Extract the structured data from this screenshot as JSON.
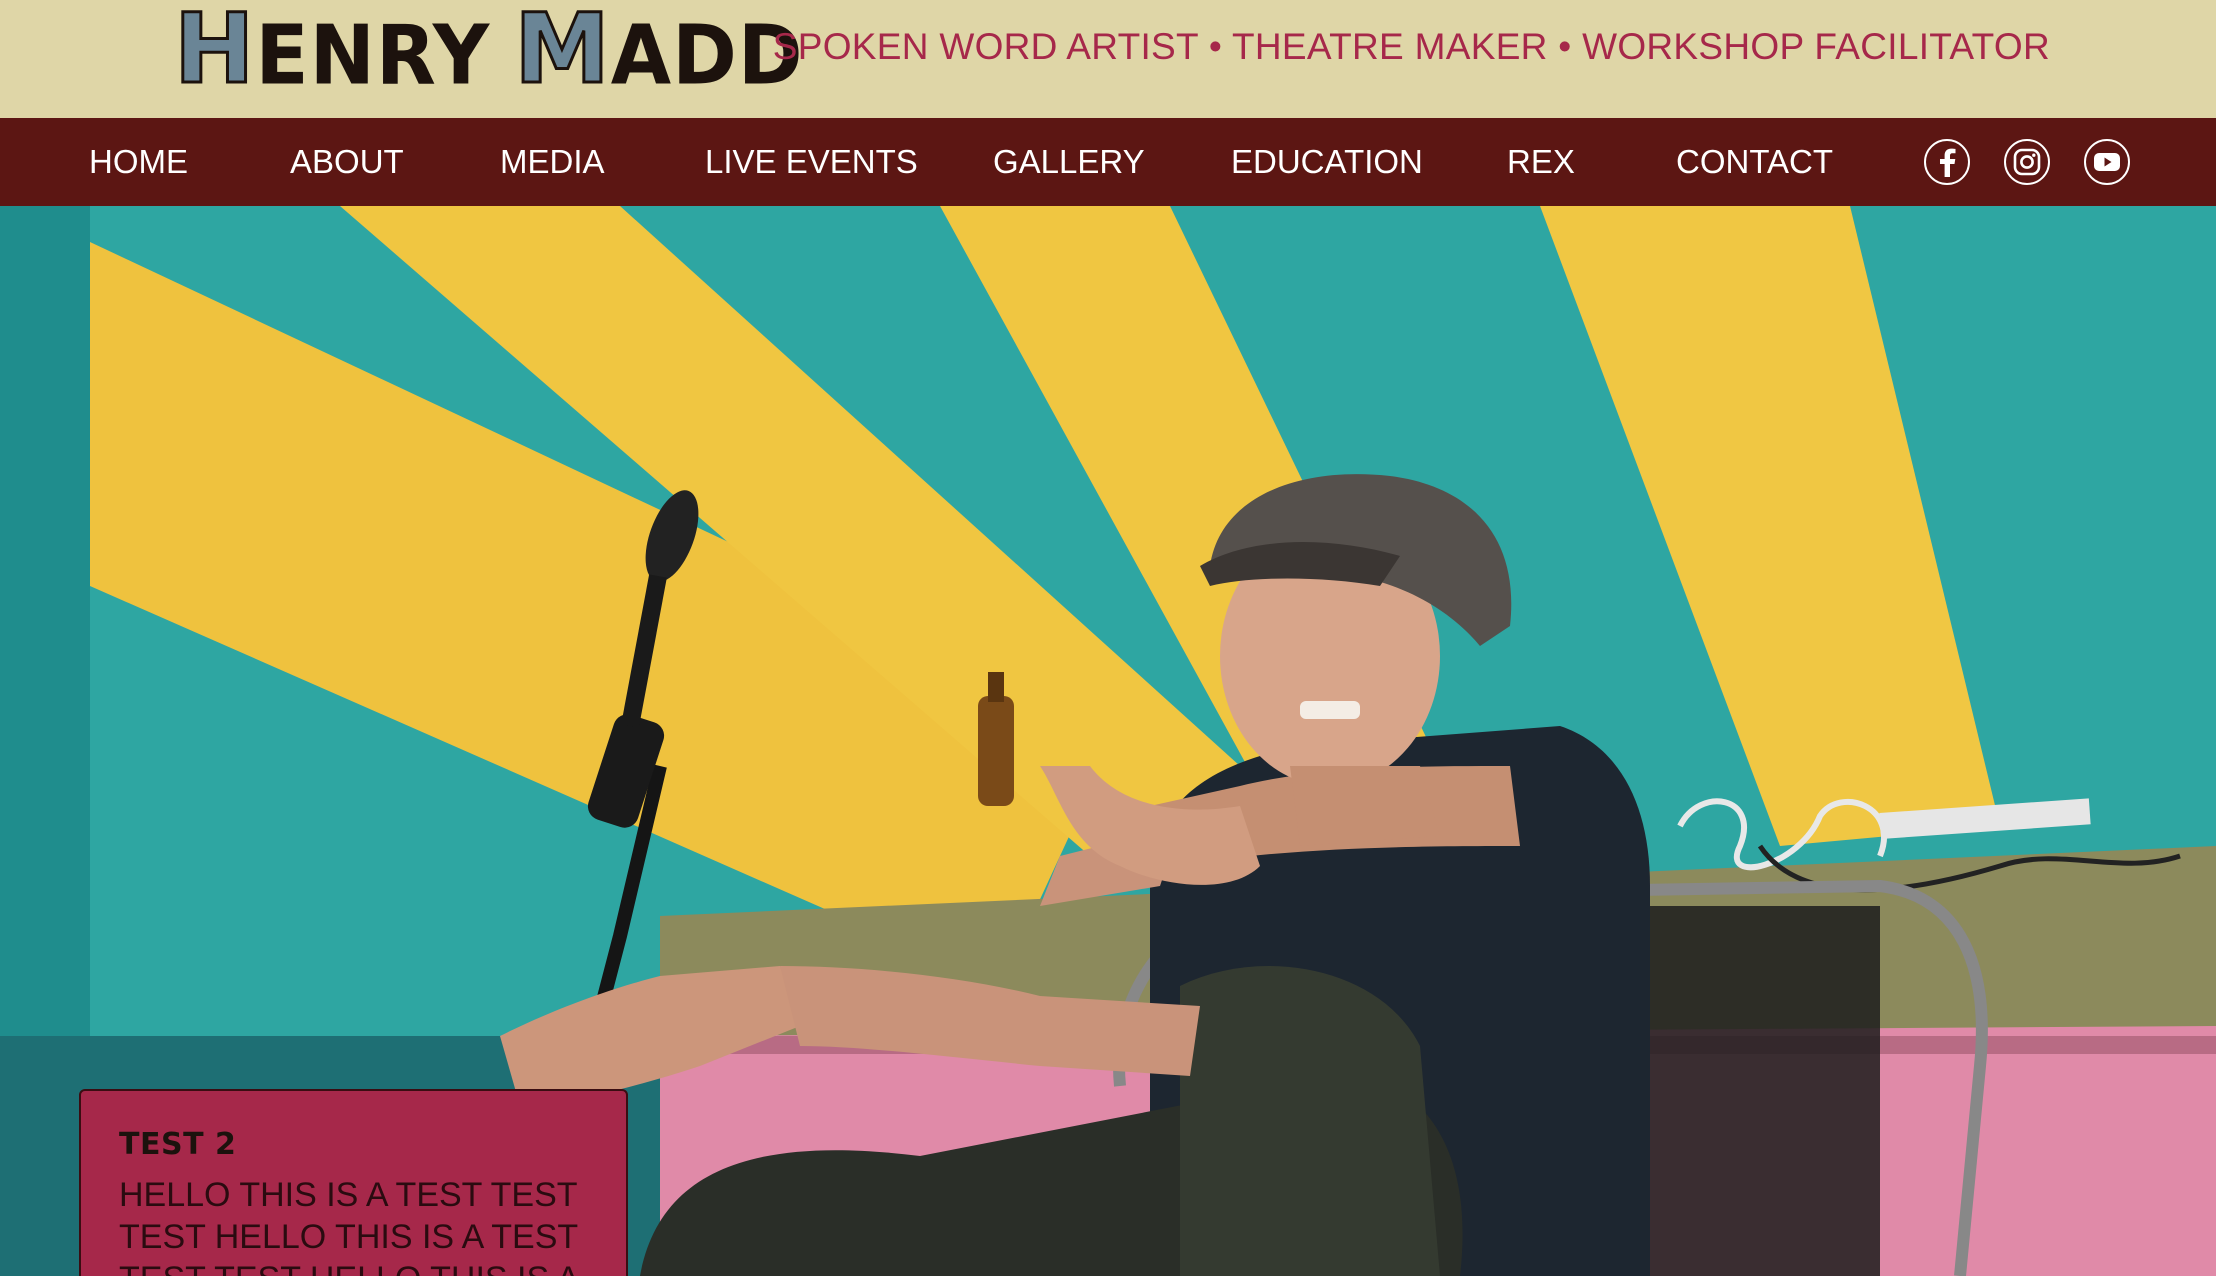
{
  "brand": {
    "first_initial": "H",
    "first_rest": "ENRY",
    "last_initial": "M",
    "last_rest": "ADD"
  },
  "header": {
    "tagline": "SPOKEN WORD ARTIST • THEATRE MAKER • WORKSHOP FACILITATOR"
  },
  "nav": {
    "items": [
      {
        "label": "HOME"
      },
      {
        "label": "ABOUT"
      },
      {
        "label": "MEDIA"
      },
      {
        "label": "LIVE EVENTS"
      },
      {
        "label": "GALLERY"
      },
      {
        "label": "EDUCATION"
      },
      {
        "label": "REX"
      },
      {
        "label": "CONTACT"
      }
    ],
    "social": [
      {
        "icon": "facebook-icon"
      },
      {
        "icon": "instagram-icon"
      },
      {
        "icon": "youtube-icon"
      }
    ]
  },
  "card": {
    "title": "TEST 2",
    "text": "HELLO THIS IS A TEST TEST TEST HELLO THIS IS A TEST TEST TEST HELLO THIS IS A"
  },
  "colors": {
    "header_bg": "#dfd6a7",
    "nav_bg": "#5c1613",
    "accent": "#a6284a",
    "logo_blue": "#6a8596"
  }
}
